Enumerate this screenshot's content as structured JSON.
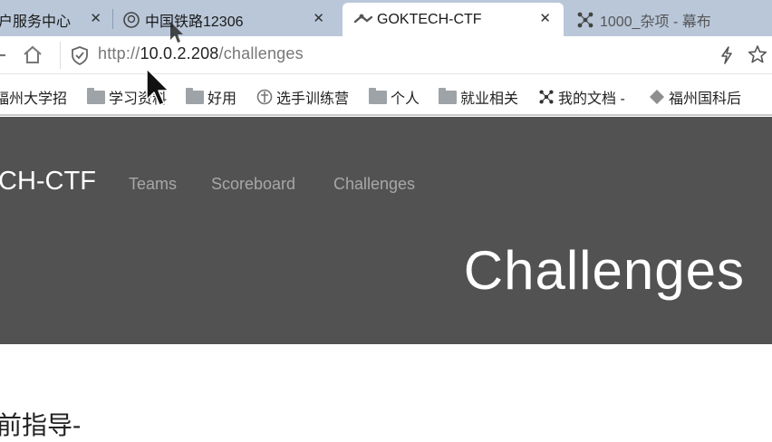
{
  "browser": {
    "tabs": [
      {
        "title": "户服务中心",
        "active": false
      },
      {
        "title": "中国铁路12306",
        "active": false
      },
      {
        "title": "GOKTECH-CTF",
        "active": true
      },
      {
        "title": "1000_杂项 - 幕布",
        "active": false
      }
    ],
    "address": {
      "protocol": "http://",
      "host": "10.0.2.208",
      "path": "/challenges"
    },
    "bookmarks": [
      {
        "label": "福州大学招",
        "icon": "folder-icon"
      },
      {
        "label": "学习资料",
        "icon": "folder-icon"
      },
      {
        "label": "好用",
        "icon": "folder-icon"
      },
      {
        "label": "选手训练营",
        "icon": "site-icon"
      },
      {
        "label": "个人",
        "icon": "folder-icon"
      },
      {
        "label": "就业相关",
        "icon": "folder-icon"
      },
      {
        "label": "我的文档 -",
        "icon": "mubu-icon"
      },
      {
        "label": "福州国科后",
        "icon": "site-icon"
      }
    ]
  },
  "site": {
    "brand": "CH-CTF",
    "nav": [
      "Teams",
      "Scoreboard",
      "Challenges"
    ],
    "hero_title": "Challenges",
    "subheading": "前指导-"
  },
  "colors": {
    "header_bg": "#525252",
    "tabbar_bg": "#b9c7d9"
  }
}
